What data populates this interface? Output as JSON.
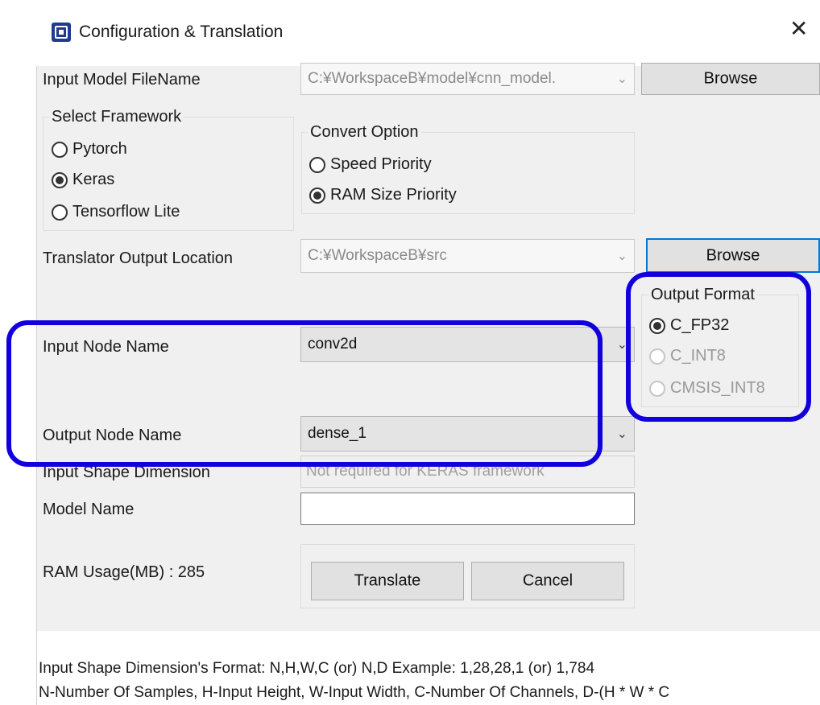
{
  "window": {
    "title": "Configuration & Translation",
    "close_glyph": "✕"
  },
  "input_model": {
    "label": "Input Model FileName",
    "value": "C:¥WorkspaceB¥model¥cnn_model.",
    "browse_label": "Browse"
  },
  "framework": {
    "title": "Select Framework",
    "options": [
      "Pytorch",
      "Keras",
      "Tensorflow Lite"
    ],
    "selected": "Keras"
  },
  "convert_option": {
    "title": "Convert Option",
    "options": [
      "Speed Priority",
      "RAM Size Priority"
    ],
    "selected": "RAM Size Priority"
  },
  "output_location": {
    "label": "Translator Output Location",
    "value": "C:¥WorkspaceB¥src",
    "browse_label": "Browse"
  },
  "output_format": {
    "title": "Output Format",
    "options": [
      "C_FP32",
      "C_INT8",
      "CMSIS_INT8"
    ],
    "selected": "C_FP32"
  },
  "input_node": {
    "label": "Input Node Name",
    "value": "conv2d"
  },
  "output_node": {
    "label": "Output Node Name",
    "value": "dense_1"
  },
  "input_shape": {
    "label": "Input Shape Dimension",
    "placeholder": "Not required for KERAS framework"
  },
  "model_name": {
    "label": "Model Name",
    "value": ""
  },
  "ram_usage": {
    "label": "RAM Usage(MB) : 285"
  },
  "actions": {
    "translate_label": "Translate",
    "cancel_label": "Cancel"
  },
  "notes": {
    "line1": "Input Shape Dimension's Format: N,H,W,C (or) N,D    Example: 1,28,28,1 (or) 1,784",
    "line2": "N-Number Of Samples, H-Input Height, W-Input Width, C-Number Of Channels, D-(H * W * C"
  },
  "colors": {
    "highlight": "#1100dd",
    "focus": "#0078d7",
    "window_bg": "#f0f0f0"
  },
  "icons": {
    "chevron": "⌄"
  }
}
